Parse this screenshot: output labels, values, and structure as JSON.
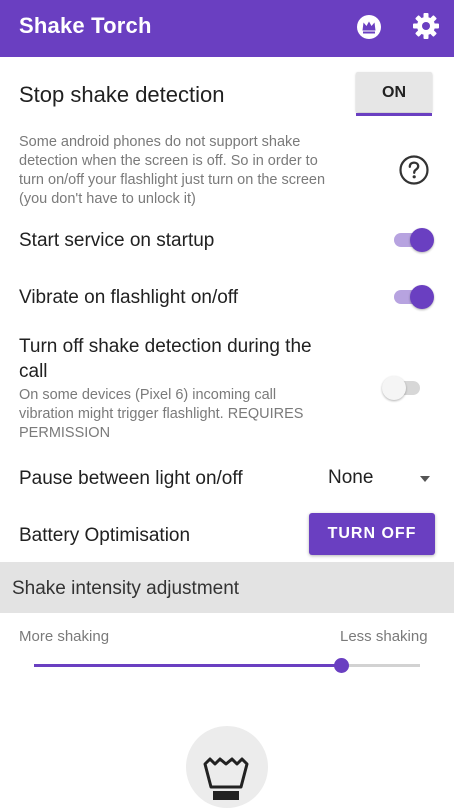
{
  "appbar": {
    "title": "Shake Torch",
    "actions": [
      {
        "icon": "crown-icon"
      },
      {
        "icon": "gear-icon"
      }
    ]
  },
  "stop_shake": {
    "title": "Stop shake detection",
    "toggle_label": "ON",
    "info_lines": [
      "Some android phones do not support shake",
      "detection when the screen is off. So in order to",
      "turn on/off your flashlight just turn on the screen",
      "(you don't have to unlock it)"
    ],
    "help_icon": "help-circle-icon"
  },
  "settings": [
    {
      "label": "Start service on startup",
      "enabled": true
    },
    {
      "label": "Vibrate on flashlight on/off",
      "enabled": true
    },
    {
      "label_lines": [
        "Turn off shake detection during the",
        "call"
      ],
      "description_lines": [
        "On some devices (Pixel 6) incoming call",
        "vibration might trigger flashlight. REQUIRES",
        "PERMISSION"
      ],
      "enabled": false
    }
  ],
  "pause": {
    "label": "Pause between light on/off",
    "selected": "None"
  },
  "battery": {
    "label": "Battery Optimisation",
    "button_label": "TURN OFF"
  },
  "intensity": {
    "section_title": "Shake intensity adjustment",
    "min_label": "More shaking",
    "max_label": "Less shaking",
    "value_fraction": 0.796
  },
  "colors": {
    "primary": "#6a3fc1",
    "switch_track_on": "#b7a3e0",
    "section_bg": "#e3e3e3",
    "secondary_text": "#7a7a7a"
  },
  "bottom_icon": "flashlight-icon"
}
